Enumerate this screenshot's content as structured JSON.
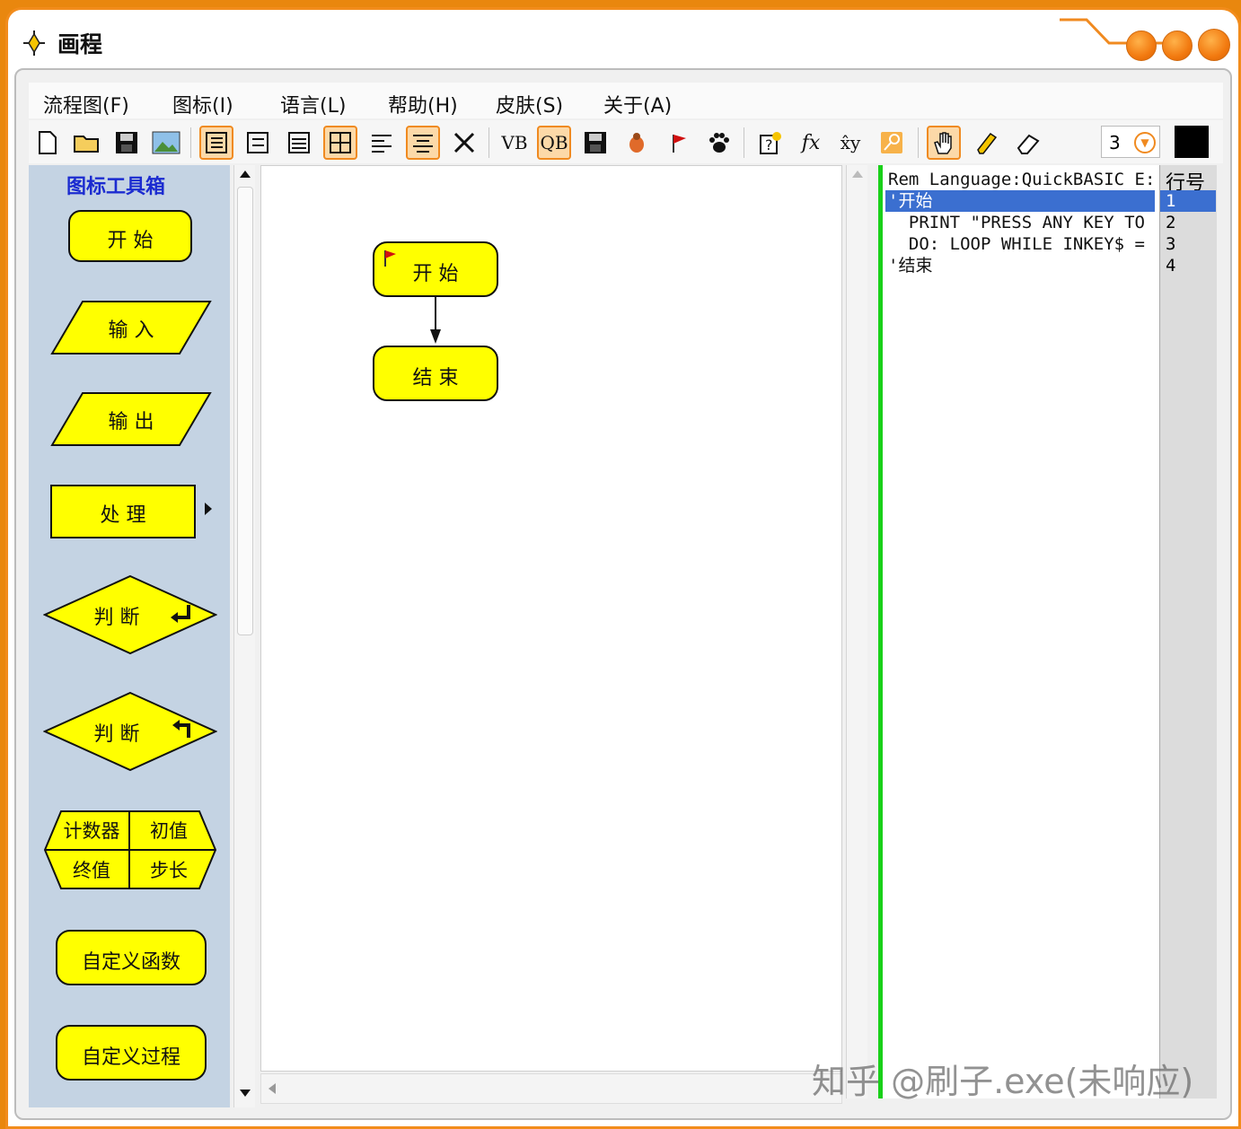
{
  "window": {
    "title": "画程"
  },
  "menu": [
    "流程图(F)",
    "图标(I)",
    "语言(L)",
    "帮助(H)",
    "皮肤(S)",
    "关于(A)"
  ],
  "toolbar": {
    "vb_label": "VB",
    "qb_label": "QB",
    "fx_label": "fx",
    "xy_label": "x̂y",
    "line_width": "3",
    "color": "#000000",
    "icons": [
      "new-file-icon",
      "open-folder-icon",
      "save-icon",
      "image-icon",
      "layout-list-icon",
      "layout-list-2-icon",
      "layout-lines-icon",
      "layout-grid-icon",
      "align-left-icon",
      "align-center-icon",
      "delete-icon",
      "vb-icon",
      "qb-icon",
      "save-code-icon",
      "bug-icon",
      "flag-icon",
      "paw-icon",
      "help-icon",
      "function-icon",
      "power-icon",
      "key-icon",
      "hand-icon",
      "pencil-icon",
      "eraser-icon"
    ]
  },
  "palette": {
    "title": "图标工具箱",
    "start": "开 始",
    "input": "输 入",
    "output": "输 出",
    "process": "处 理",
    "decision_yes": "判 断",
    "decision_no": "判 断",
    "loop": {
      "counter": "计数器",
      "init": "初值",
      "end": "终值",
      "step": "步长"
    },
    "user_func": "自定义函数",
    "user_proc": "自定义过程"
  },
  "canvas": {
    "start_label": "开 始",
    "end_label": "结 束"
  },
  "code": {
    "header": "Rem Language:QuickBASIC E:",
    "lines": [
      "'开始",
      "  PRINT \"PRESS ANY KEY TO",
      "  DO: LOOP WHILE INKEY$ =",
      "'结束"
    ],
    "line_header": "行号",
    "line_numbers": [
      "1",
      "2",
      "3",
      "4"
    ],
    "selected_line": 1
  },
  "watermark": "知乎 @刷子.exe(未响应)"
}
